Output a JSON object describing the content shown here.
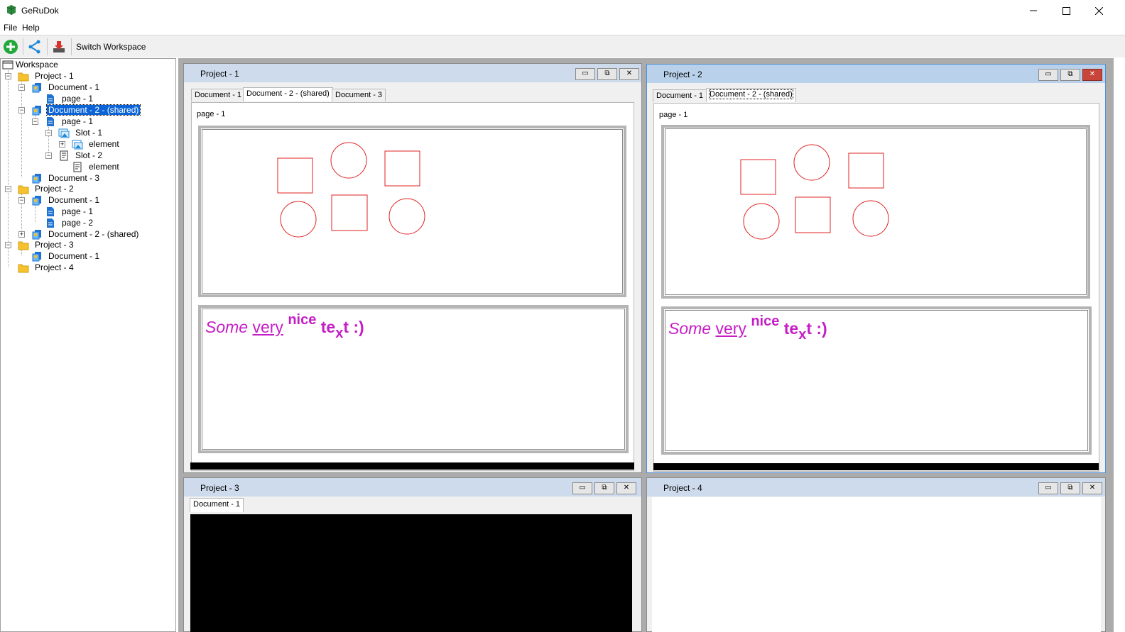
{
  "window": {
    "title": "GeRuDok",
    "minimize": "—",
    "maximize": "☐",
    "close": "✕"
  },
  "menu": {
    "file": "File",
    "help": "Help"
  },
  "toolbar": {
    "add_icon": "add-icon",
    "share_icon": "share-icon",
    "save_icon": "save-icon",
    "switch_workspace": "Switch Workspace"
  },
  "tree": {
    "workspace": "Workspace",
    "project1": "Project - 1",
    "p1_doc1": "Document - 1",
    "p1_doc1_page1": "page - 1",
    "p1_doc2": "Document - 2 - (shared)",
    "p1_doc2_page1": "page - 1",
    "slot1": "Slot - 1",
    "slot1_element": "element",
    "slot2": "Slot - 2",
    "slot2_element": "element",
    "p1_doc3": "Document - 3",
    "project2": "Project - 2",
    "p2_doc1": "Document - 1",
    "p2_doc1_page1": "page - 1",
    "p2_doc1_page2": "page - 2",
    "p2_doc2": "Document - 2 - (shared)",
    "project3": "Project - 3",
    "p3_doc1": "Document - 1",
    "project4": "Project - 4"
  },
  "windows": {
    "project1": {
      "title": "Project - 1",
      "tabs": [
        "Document - 1",
        "Document - 2 - (shared)",
        "Document - 3"
      ],
      "page_label": "page - 1"
    },
    "project2": {
      "title": "Project - 2",
      "tabs": [
        "Document - 1",
        "Document - 2 - (shared)"
      ],
      "page_label": "page - 1"
    },
    "project3": {
      "title": "Project - 3",
      "tabs": [
        "Document - 1"
      ]
    },
    "project4": {
      "title": "Project - 4"
    }
  },
  "rich_text": {
    "some": "Some",
    "very": "very",
    "nice": "nice",
    "te": "te",
    "x": "x",
    "tail": "t :)"
  },
  "colors": {
    "accent_magenta": "#c61ec6",
    "shape_red": "#e02020",
    "selection_blue": "#0a64d8"
  }
}
